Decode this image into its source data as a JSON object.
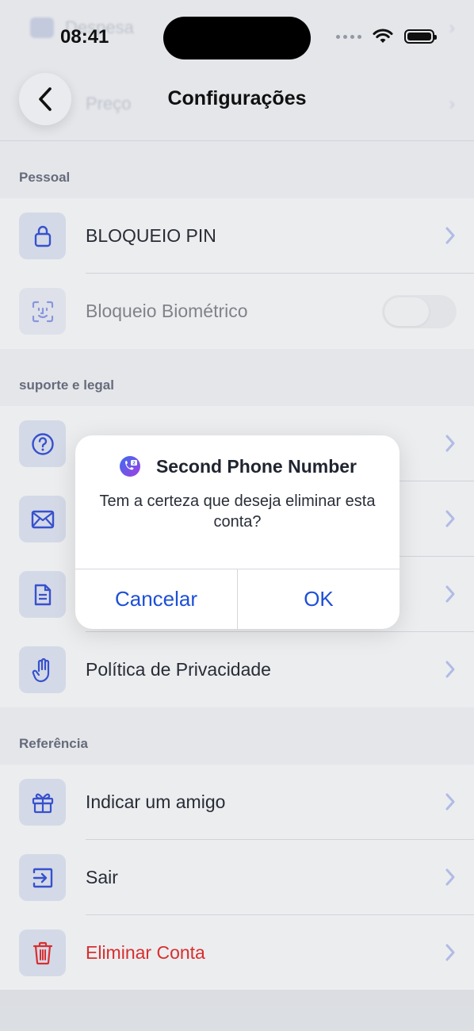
{
  "status_bar": {
    "time": "08:41"
  },
  "header": {
    "title": "Configurações",
    "ghost_rows": [
      "Despesa",
      "Preço"
    ]
  },
  "sections": [
    {
      "title": "Pessoal",
      "items": [
        {
          "label": "BLOQUEIO PIN",
          "icon": "lock-icon",
          "control": "chevron"
        },
        {
          "label": "Bloqueio Biométrico",
          "icon": "face-id-icon",
          "control": "toggle",
          "toggle_on": false
        }
      ]
    },
    {
      "title": "suporte e legal",
      "items": [
        {
          "label": "",
          "icon": "help-circle-icon",
          "control": "chevron"
        },
        {
          "label": "",
          "icon": "mail-icon",
          "control": "chevron"
        },
        {
          "label": "",
          "icon": "document-icon",
          "control": "chevron"
        },
        {
          "label": "Política de Privacidade",
          "icon": "hand-icon",
          "control": "chevron"
        }
      ]
    },
    {
      "title": "Referência",
      "items": [
        {
          "label": "Indicar um amigo",
          "icon": "gift-icon",
          "control": "chevron"
        },
        {
          "label": "Sair",
          "icon": "logout-icon",
          "control": "chevron"
        },
        {
          "label": "Eliminar Conta",
          "icon": "trash-icon",
          "control": "chevron",
          "danger": true
        }
      ]
    }
  ],
  "dialog": {
    "app_name": "Second Phone Number",
    "message": "Tem a certeza que deseja eliminar esta conta?",
    "cancel_label": "Cancelar",
    "ok_label": "OK"
  },
  "colors": {
    "accent": "#1d4fd8",
    "icon_blue": "#3a55d6",
    "danger": "#e03131",
    "chevron": "#b9c3ee"
  }
}
